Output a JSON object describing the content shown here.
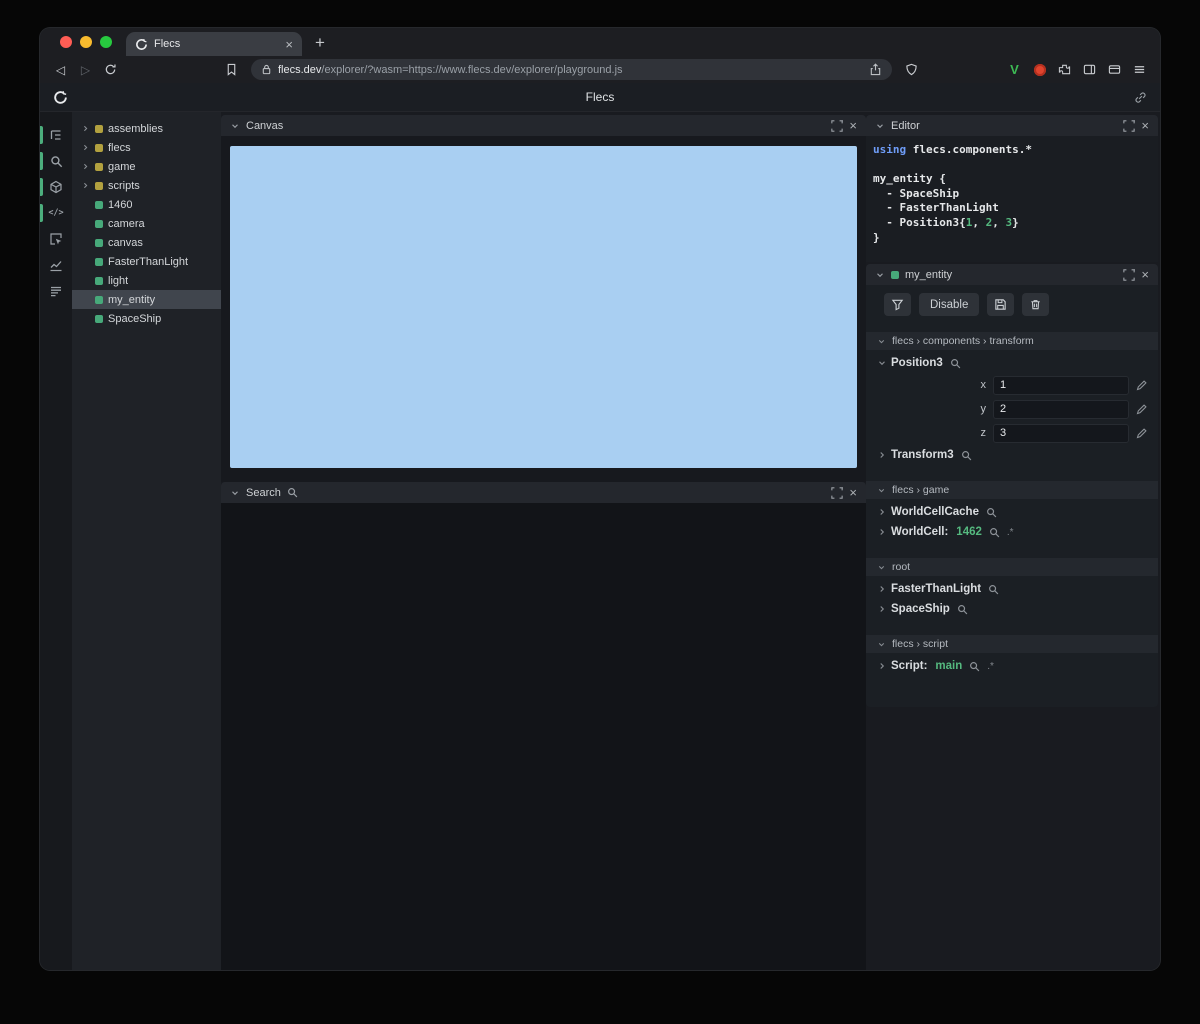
{
  "icons": {
    "close_glyph": "×",
    "newtab_glyph": "+",
    "back_glyph": "◁",
    "forward_glyph": "▷",
    "code_glyph": "</>",
    "instance_glyph": ".*",
    "v_ext_glyph": "V"
  },
  "browser": {
    "tab_title": "Flecs",
    "address_domain": "flecs.dev",
    "address_path": "/explorer/?wasm=https://www.flecs.dev/explorer/playground.js"
  },
  "app": {
    "title": "Flecs"
  },
  "tree": {
    "items": [
      {
        "label": "assemblies",
        "kind": "module",
        "expandable": true
      },
      {
        "label": "flecs",
        "kind": "module",
        "expandable": true
      },
      {
        "label": "game",
        "kind": "module",
        "expandable": true
      },
      {
        "label": "scripts",
        "kind": "module",
        "expandable": true
      },
      {
        "label": "1460",
        "kind": "entity"
      },
      {
        "label": "camera",
        "kind": "entity"
      },
      {
        "label": "canvas",
        "kind": "entity"
      },
      {
        "label": "FasterThanLight",
        "kind": "entity"
      },
      {
        "label": "light",
        "kind": "entity"
      },
      {
        "label": "my_entity",
        "kind": "entity",
        "selected": true
      },
      {
        "label": "SpaceShip",
        "kind": "entity"
      }
    ]
  },
  "panels": {
    "canvas_title": "Canvas",
    "search_title": "Search",
    "editor_title": "Editor"
  },
  "editor_code": {
    "lines": [
      {
        "kw": "using",
        "rest": " flecs.components.*"
      },
      {
        "blank": true
      },
      {
        "text": "my_entity {"
      },
      {
        "text": "  - SpaceShip"
      },
      {
        "text": "  - FasterThanLight"
      },
      {
        "p0": "  - Position3{",
        "n1": "1",
        "c1": ", ",
        "n2": "2",
        "c2": ", ",
        "n3": "3",
        "p1": "}"
      },
      {
        "text": "}"
      }
    ]
  },
  "inspector": {
    "header_title": "my_entity",
    "toolbar": {
      "disable_label": "Disable"
    },
    "sections": [
      {
        "path": "flecs › components › transform",
        "rows": [
          {
            "name": "Position3",
            "expanded": true,
            "fields": [
              {
                "label": "x",
                "value": "1"
              },
              {
                "label": "y",
                "value": "2"
              },
              {
                "label": "z",
                "value": "3"
              }
            ]
          },
          {
            "name": "Transform3"
          }
        ]
      },
      {
        "path": "flecs › game",
        "rows": [
          {
            "name": "WorldCellCache"
          },
          {
            "name": "WorldCell:",
            "value": "1462"
          }
        ]
      },
      {
        "path": "root",
        "rows": [
          {
            "name": "FasterThanLight"
          },
          {
            "name": "SpaceShip"
          }
        ]
      },
      {
        "path": "flecs › script",
        "rows": [
          {
            "name": "Script:",
            "value": "main"
          }
        ]
      }
    ]
  }
}
